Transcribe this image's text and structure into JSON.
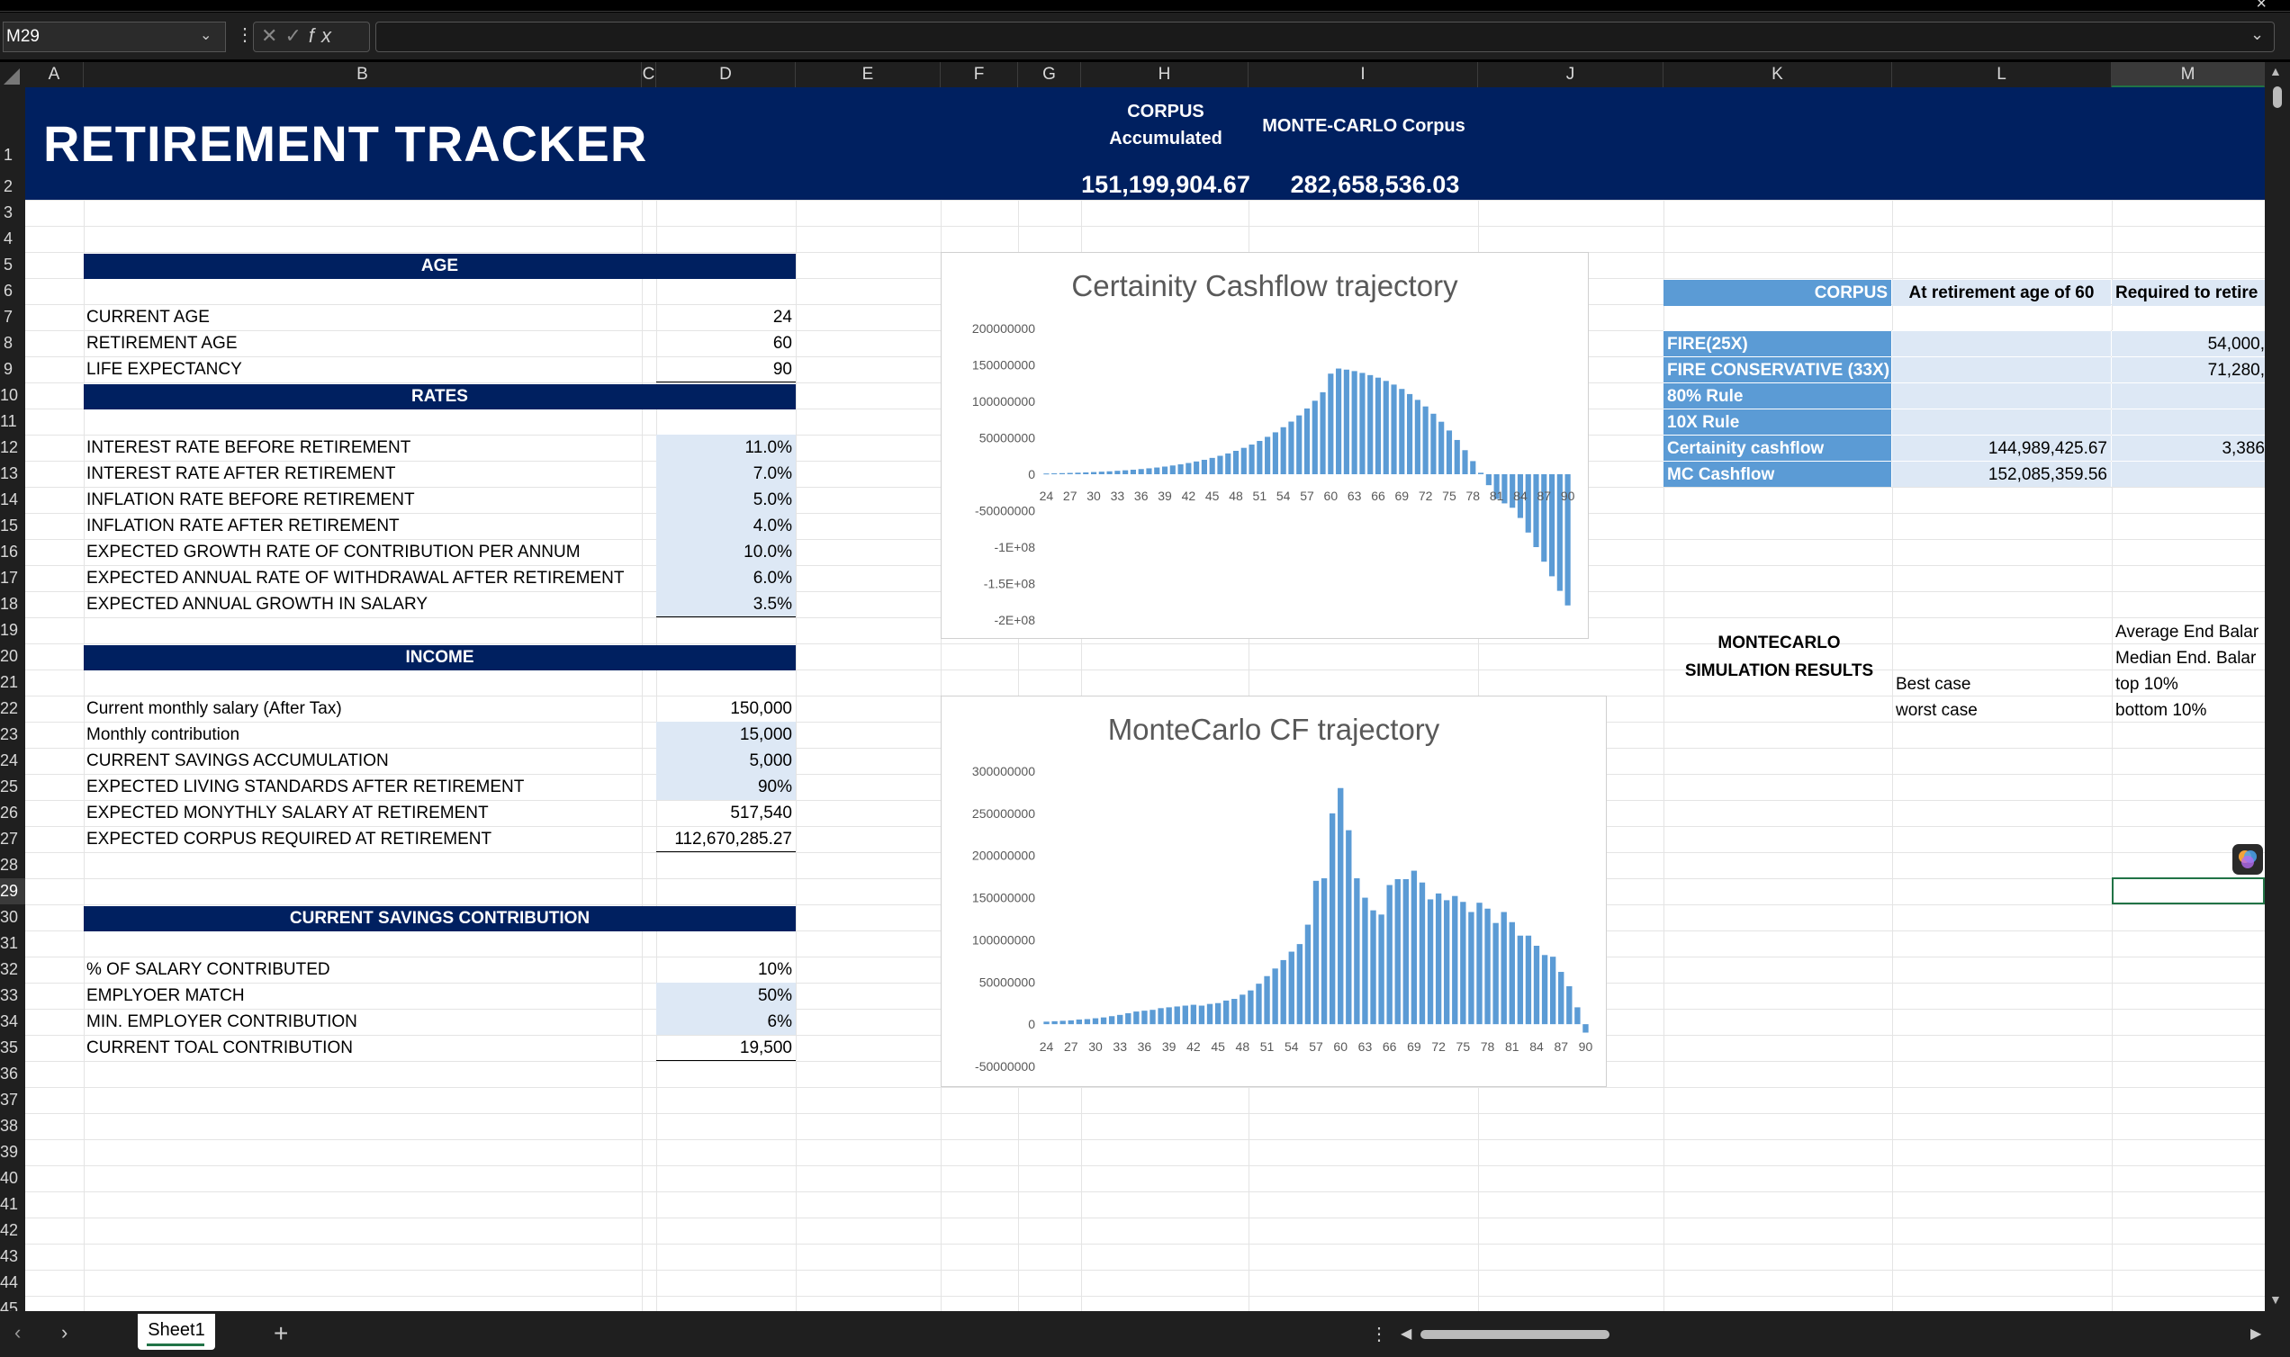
{
  "formula_bar": {
    "name_box": "M29",
    "fx_label": "fx",
    "formula": ""
  },
  "columns": [
    "A",
    "B",
    "C",
    "D",
    "E",
    "F",
    "G",
    "H",
    "I",
    "J",
    "K",
    "L",
    "M"
  ],
  "rows": [
    "1",
    "2",
    "3",
    "4",
    "5",
    "6",
    "7",
    "8",
    "9",
    "10",
    "11",
    "12",
    "13",
    "14",
    "15",
    "16",
    "17",
    "18",
    "19",
    "20",
    "21",
    "22",
    "23",
    "24",
    "25",
    "26",
    "27",
    "28",
    "29",
    "30",
    "31",
    "32",
    "33",
    "34",
    "35",
    "36",
    "37",
    "38",
    "39",
    "40",
    "41",
    "42",
    "43",
    "44",
    "45"
  ],
  "banner": {
    "title": "RETIREMENT TRACKER",
    "corpus_label_1": "CORPUS",
    "corpus_label_2": "Accumulated",
    "mc_label": "MONTE-CARLO Corpus",
    "corpus_value": "151,199,904.67",
    "mc_value": "282,658,536.03"
  },
  "age": {
    "header": "AGE",
    "rows": [
      {
        "label": "CURRENT AGE",
        "value": "24"
      },
      {
        "label": "RETIREMENT AGE",
        "value": "60"
      },
      {
        "label": "LIFE EXPECTANCY",
        "value": "90"
      }
    ]
  },
  "rates": {
    "header": "RATES",
    "rows": [
      {
        "label": "INTEREST RATE BEFORE RETIREMENT",
        "value": "11.0%"
      },
      {
        "label": "INTEREST RATE AFTER RETIREMENT",
        "value": "7.0%"
      },
      {
        "label": "INFLATION RATE BEFORE RETIREMENT",
        "value": "5.0%"
      },
      {
        "label": "INFLATION RATE AFTER RETIREMENT",
        "value": "4.0%"
      },
      {
        "label": "EXPECTED GROWTH RATE OF CONTRIBUTION PER ANNUM",
        "value": "10.0%"
      },
      {
        "label": "EXPECTED ANNUAL RATE OF WITHDRAWAL AFTER RETIREMENT",
        "value": "6.0%"
      },
      {
        "label": "EXPECTED ANNUAL GROWTH IN SALARY",
        "value": "3.5%"
      }
    ]
  },
  "income": {
    "header": "INCOME",
    "rows": [
      {
        "label": "Current monthly salary (After Tax)",
        "value": "150,000"
      },
      {
        "label": "Monthly contribution",
        "value": "15,000"
      },
      {
        "label": "CURRENT SAVINGS ACCUMULATION",
        "value": "5,000"
      },
      {
        "label": "EXPECTED LIVING STANDARDS AFTER RETIREMENT",
        "value": "90%"
      },
      {
        "label": "EXPECTED MONYTHLY SALARY AT RETIREMENT",
        "value": "517,540"
      },
      {
        "label": "EXPECTED CORPUS REQUIRED AT RETIREMENT",
        "value": "112,670,285.27"
      }
    ]
  },
  "contribution": {
    "header": "CURRENT SAVINGS CONTRIBUTION",
    "rows": [
      {
        "label": "% OF SALARY CONTRIBUTED",
        "value": "10%"
      },
      {
        "label": "EMPLYOER MATCH",
        "value": "50%"
      },
      {
        "label": "MIN. EMPLOYER CONTRIBUTION",
        "value": "6%"
      },
      {
        "label": "CURRENT TOAL CONTRIBUTION",
        "value": "19,500"
      }
    ]
  },
  "corpus_table": {
    "header_k": "CORPUS",
    "header_l": "At retirement age of 60",
    "header_m": "Required to retire",
    "rows": [
      {
        "label": "FIRE(25X)",
        "l": "",
        "m": "54,000,"
      },
      {
        "label": "FIRE CONSERVATIVE (33X)",
        "l": "",
        "m": "71,280,"
      },
      {
        "label": "80% Rule",
        "l": "",
        "m": ""
      },
      {
        "label": "10X Rule",
        "l": "",
        "m": ""
      },
      {
        "label": "Certainity cashflow",
        "l": "144,989,425.67",
        "m": "3,386"
      },
      {
        "label": "MC Cashflow",
        "l": "152,085,359.56",
        "m": ""
      }
    ]
  },
  "montecarlo": {
    "title_1": "MONTECARLO",
    "title_2": "SIMULATION RESULTS",
    "best_case": "Best case",
    "worst_case": "worst case",
    "avg_end": "Average End Balar",
    "median_end": "Median End. Balar",
    "top10": "top 10%",
    "bottom10": "bottom 10%"
  },
  "tabs": {
    "sheet1": "Sheet1",
    "add": "+"
  },
  "chart_data": [
    {
      "type": "bar",
      "title": "Certainity Cashflow trajectory",
      "y_ticks": [
        "200000000",
        "150000000",
        "100000000",
        "50000000",
        "0",
        "-50000000",
        "-1E+08",
        "-1.5E+08",
        "-2E+08"
      ],
      "ylim": [
        -200000000,
        200000000
      ],
      "x_tick_labels": [
        "24",
        "27",
        "30",
        "33",
        "36",
        "39",
        "42",
        "45",
        "48",
        "51",
        "54",
        "57",
        "60",
        "63",
        "66",
        "69",
        "72",
        "75",
        "78",
        "81",
        "84",
        "87",
        "90"
      ],
      "categories": [
        24,
        25,
        26,
        27,
        28,
        29,
        30,
        31,
        32,
        33,
        34,
        35,
        36,
        37,
        38,
        39,
        40,
        41,
        42,
        43,
        44,
        45,
        46,
        47,
        48,
        49,
        50,
        51,
        52,
        53,
        54,
        55,
        56,
        57,
        58,
        59,
        60,
        61,
        62,
        63,
        64,
        65,
        66,
        67,
        68,
        69,
        70,
        71,
        72,
        73,
        74,
        75,
        76,
        77,
        78,
        79,
        80,
        81,
        82,
        83,
        84,
        85,
        86,
        87,
        88,
        89,
        90
      ],
      "values": [
        1000000,
        1200000,
        1500000,
        1800000,
        2100000,
        2500000,
        3000000,
        3500000,
        4000000,
        4700000,
        5400000,
        6200000,
        7100000,
        8100000,
        9200000,
        10500000,
        12000000,
        13600000,
        15400000,
        17500000,
        19800000,
        22400000,
        25300000,
        28500000,
        32100000,
        36200000,
        40700000,
        45700000,
        51300000,
        57500000,
        64500000,
        72200000,
        80700000,
        90200000,
        100800000,
        112500000,
        138000000,
        144989425,
        143500000,
        141500000,
        139000000,
        136000000,
        132500000,
        128000000,
        123000000,
        117000000,
        110000000,
        102000000,
        93000000,
        83000000,
        72000000,
        60000000,
        47000000,
        33000000,
        18000000,
        2000000,
        -15000000,
        -34000000,
        -40000000,
        -46000000,
        -60000000,
        -80000000,
        -100000000,
        -120000000,
        -140000000,
        -160000000,
        -180000000
      ]
    },
    {
      "type": "bar",
      "title": "MonteCarlo CF trajectory",
      "y_ticks": [
        "300000000",
        "250000000",
        "200000000",
        "150000000",
        "100000000",
        "50000000",
        "0",
        "-50000000"
      ],
      "ylim": [
        -50000000,
        300000000
      ],
      "x_tick_labels": [
        "24",
        "27",
        "30",
        "33",
        "36",
        "39",
        "42",
        "45",
        "48",
        "51",
        "54",
        "57",
        "60",
        "63",
        "66",
        "69",
        "72",
        "75",
        "78",
        "81",
        "84",
        "87",
        "90"
      ],
      "categories": [
        24,
        25,
        26,
        27,
        28,
        29,
        30,
        31,
        32,
        33,
        34,
        35,
        36,
        37,
        38,
        39,
        40,
        41,
        42,
        43,
        44,
        45,
        46,
        47,
        48,
        49,
        50,
        51,
        52,
        53,
        54,
        55,
        56,
        57,
        58,
        59,
        60,
        61,
        62,
        63,
        64,
        65,
        66,
        67,
        68,
        69,
        70,
        71,
        72,
        73,
        74,
        75,
        76,
        77,
        78,
        79,
        80,
        81,
        82,
        83,
        84,
        85,
        86,
        87,
        88,
        89,
        90
      ],
      "values": [
        3000000,
        3500000,
        4000000,
        4500000,
        5500000,
        6000000,
        7000000,
        8000000,
        9500000,
        11000000,
        13000000,
        15000000,
        16000000,
        17000000,
        19000000,
        20000000,
        21000000,
        22000000,
        23000000,
        22000000,
        24000000,
        25000000,
        28000000,
        30000000,
        35000000,
        40000000,
        48000000,
        57000000,
        66000000,
        76000000,
        86000000,
        95000000,
        118000000,
        170000000,
        173000000,
        250000000,
        280000000,
        230000000,
        173000000,
        150000000,
        135000000,
        130000000,
        165000000,
        172000000,
        172000000,
        182000000,
        168000000,
        148000000,
        155000000,
        147000000,
        152000000,
        145000000,
        133000000,
        144000000,
        137000000,
        120000000,
        133000000,
        121000000,
        105000000,
        105000000,
        93000000,
        82000000,
        80000000,
        62000000,
        45000000,
        20000000,
        -10000000
      ]
    }
  ]
}
